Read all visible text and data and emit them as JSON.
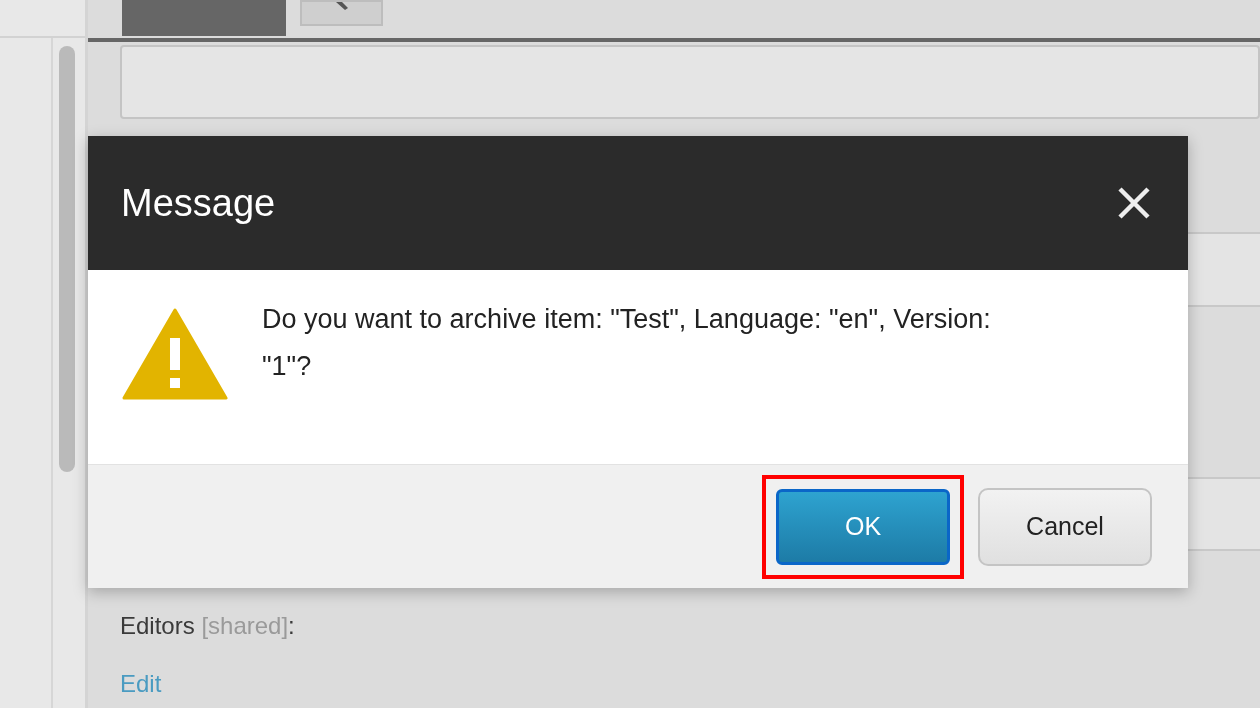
{
  "tabs": [
    {
      "kind": "blank",
      "selected": true
    },
    {
      "kind": "icon",
      "selected": false
    }
  ],
  "field_label": {
    "label": "Editors",
    "qualifier": "[shared]",
    "suffix": ":"
  },
  "edit_link": "Edit",
  "dialog": {
    "title": "Message",
    "message": "Do you want to archive item: \"Test\", Language: \"en\", Version: \"1\"?",
    "buttons": [
      {
        "label": "OK",
        "kind": "primary",
        "highlighted": true
      },
      {
        "label": "Cancel",
        "kind": "secondary",
        "highlighted": false
      }
    ]
  }
}
